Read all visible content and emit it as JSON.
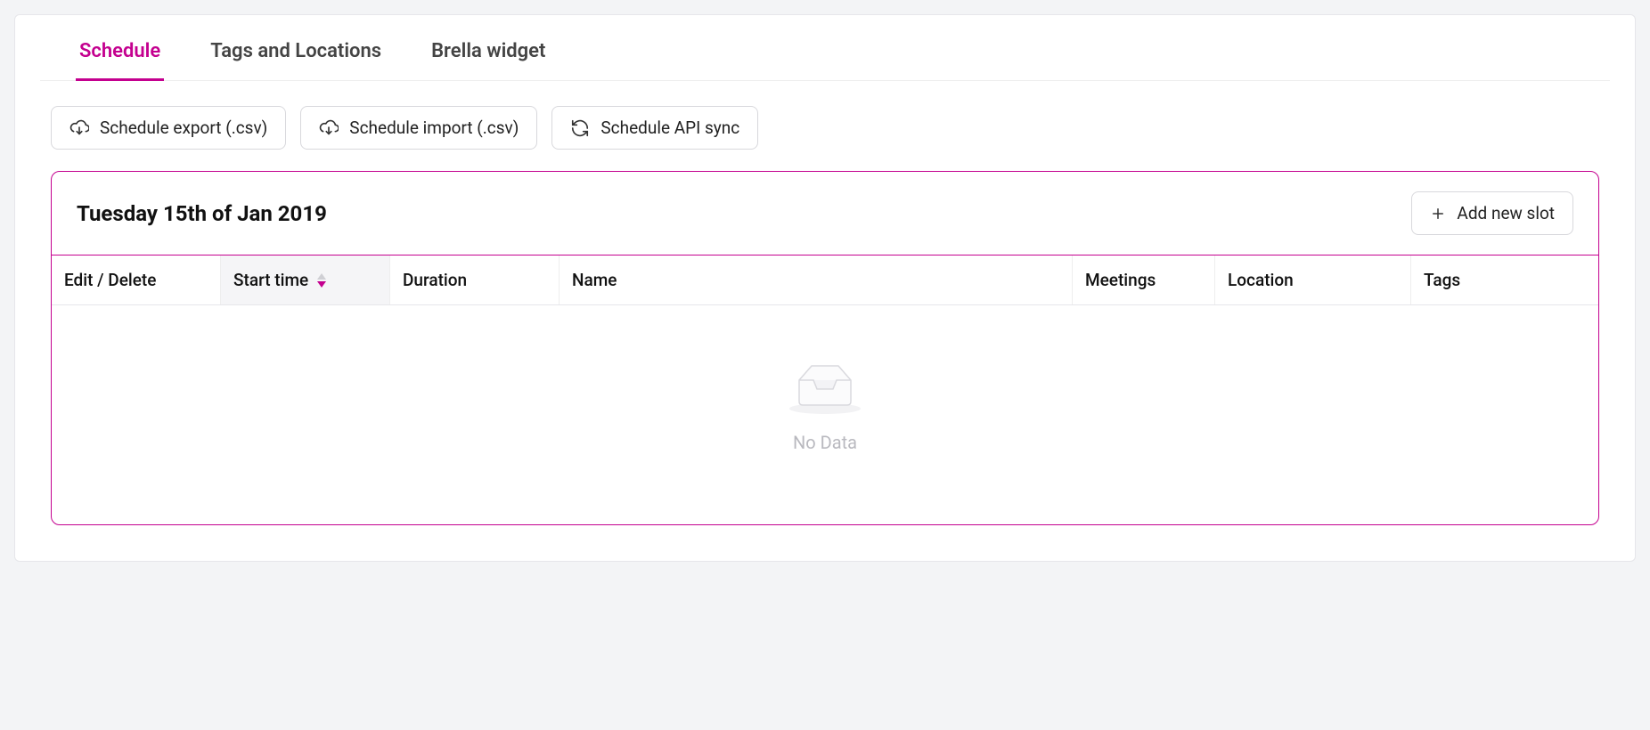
{
  "tabs": [
    {
      "label": "Schedule",
      "active": true
    },
    {
      "label": "Tags and Locations",
      "active": false
    },
    {
      "label": "Brella widget",
      "active": false
    }
  ],
  "toolbar": {
    "export_label": "Schedule export (.csv)",
    "import_label": "Schedule import (.csv)",
    "sync_label": "Schedule API sync"
  },
  "day": {
    "title": "Tuesday 15th of Jan 2019",
    "add_slot_label": "Add new slot"
  },
  "columns": {
    "edit": "Edit / Delete",
    "start": "Start time",
    "duration": "Duration",
    "name": "Name",
    "meetings": "Meetings",
    "location": "Location",
    "tags": "Tags"
  },
  "sort": {
    "column": "start",
    "direction": "asc"
  },
  "rows": [],
  "empty_label": "No Data",
  "colors": {
    "accent": "#c4008f"
  }
}
